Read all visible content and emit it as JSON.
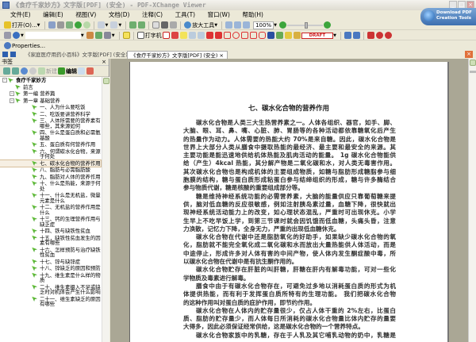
{
  "window": {
    "title": "《食疗千家妙方》文字版[PDF] (安全) - PDF-XChange Viewer"
  },
  "menu": [
    "文件(E)",
    "编辑(E)",
    "视图(V)",
    "文档(D)",
    "注释(C)",
    "工具(T)",
    "窗口(W)",
    "帮助(H)"
  ],
  "toolbar": {
    "open_label": "打开(O)...",
    "zoom_tool_label": "放大工具",
    "zoom_value": "100%",
    "typewriter_label": "打字机",
    "stamp_label": "DRAFT",
    "properties_label": "Properties..."
  },
  "download_badge": {
    "line1": "Download PDF",
    "line2": "Creation Tools"
  },
  "tabs": [
    {
      "label": "《家庭医疗用药小百科》文字版[PDF] (安全)"
    },
    {
      "label": "《食疗千家妙方》文字版[PDF] (安全)",
      "active": true
    }
  ],
  "bookmarks_pane": {
    "title": "书签",
    "new_label": "新建",
    "edit_label": "编辑"
  },
  "tree": [
    {
      "label": "食疗千家妙方",
      "level": 0,
      "expander": "⊟"
    },
    {
      "label": "前言",
      "level": 1
    },
    {
      "label": "第一编 营养篇",
      "level": 1,
      "expander": "⊟"
    },
    {
      "label": "第一章 基础营养",
      "level": 2,
      "expander": "⊟"
    },
    {
      "label": "一、人为什么要吃饭",
      "level": 3
    },
    {
      "label": "二、吃饭要讲营养科学",
      "level": 3
    },
    {
      "label": "三、人体所需要的营养素有哪些，其来源如何",
      "level": 3
    },
    {
      "label": "四、什么是蛋白质和必需氨基酸",
      "level": 3
    },
    {
      "label": "五、蛋白质有何营养作用",
      "level": 3
    },
    {
      "label": "六、何谓碳水化合物，来源于何处",
      "level": 3
    },
    {
      "label": "七、碳水化合物的营养作用",
      "level": 3,
      "selected": true
    },
    {
      "label": "八、脂肪与必需脂肪酸",
      "level": 3
    },
    {
      "label": "九、脂肪对人体的营养作用",
      "level": 3
    },
    {
      "label": "十、什么是热能，来源于何处",
      "level": 3
    },
    {
      "label": "十一、什么是无机盐，微量元素是什么",
      "level": 3
    },
    {
      "label": "十二、无机盐的营养作用是什么",
      "level": 3
    },
    {
      "label": "十三、钙的生理营养作用与缺乏症",
      "level": 3
    },
    {
      "label": "十四、铁与缺铁性贫血",
      "level": 3
    },
    {
      "label": "十五，缺铁性贫血发生的因素有哪些",
      "level": 3
    },
    {
      "label": "十六、怎样预防与治疗缺铁性贫血",
      "level": 3
    },
    {
      "label": "十七、锌与缺锌症",
      "level": 3
    },
    {
      "label": "十八、锌缺乏的原因和预防",
      "level": 3
    },
    {
      "label": "十九、维生素是什么样的物质",
      "level": 3
    },
    {
      "label": "二十、维生素摄入不足或缺乏时对机体会产生什么影响",
      "level": 3
    },
    {
      "label": "二十一、维生素缺乏的原因有哪些",
      "level": 3
    }
  ],
  "document": {
    "heading": "七、碳水化合物的营养作用",
    "lines": [
      {
        "t": "碳水化合物是人类三大生热营养素之一。人体各组织、器官，如手、脚、",
        "i": true
      },
      {
        "t": "大脑、眼、耳、鼻、嘴、心脏、肺、胃肠等的各种活动都依靠糖氧化后产生"
      },
      {
        "t": "的热量作为动力。人体需要的热能大约 70%是来自糖。因此，碳水化合物是"
      },
      {
        "t": "世界上大部分人类从膳食中摄取热能的最经济、最主要和最安全的来源。其"
      },
      {
        "t": "主要功能是能迅速地供给机体热能及肌肉活动的能量。 1g 碳水化合物能供"
      },
      {
        "t": "给（产生）4kcal 热能，其分解产物是二氧化碳和水，对人类无毒害作用。"
      },
      {
        "t": "其次碳水化合物也是构成机体的主要组成物质，如糖与脂肪形成糖脂参与细"
      },
      {
        "t": "胞膜的结构，糖与蛋白质形成粘蛋白参与结缔组织的形成，糖与许多酶结合"
      },
      {
        "t": "参与物质代谢，糖是核酸的重要组成部分等。",
        "e": true
      },
      {
        "t": "糖是维持神经系统功能的必需营养素，大脑的能量供应只靠葡萄糖来提",
        "i": true
      },
      {
        "t": "供，脑对低血糖的反应很敏感，例如注射胰岛素过量，血糖下降，很快就出"
      },
      {
        "t": "现神经系统活动能力上的改变，如心理状态混乱，严重时可出现休克。小学"
      },
      {
        "t": "生早上不吃早饭上学，到第三节课时就会因饥饿而低血糖，头痛头昏，注意"
      },
      {
        "t": "力涣散，记忆力下降，全身无力，严重的出现低血糖休克。",
        "e": true
      },
      {
        "t": "碳水化合物在代谢中还是脂肪氧化的好助手，如果缺少碳水化合物的氧",
        "i": true
      },
      {
        "t": "化，脂肪就不能完全氧化成二氧化碳和水而放出大量热能供人体活动，而是"
      },
      {
        "t": "中途停止，形成许多对人体有害的中间产物，使人体内发生酮症酸中毒，所"
      },
      {
        "t": "以碳水化合物在代谢中是有抗生酮作用的。",
        "e": true
      },
      {
        "t": "碳水化合物贮存在肝脏的叫肝糖，肝糖在肝内有解毒功能，可对一些化",
        "i": true
      },
      {
        "t": "学物质及毒素进行解毒。",
        "e": true
      },
      {
        "t": "膳食中由于有碳水化合物存在，可避免过多地以消耗蛋白质的形式为机",
        "i": true
      },
      {
        "t": "体提供热能，而有利于发挥蛋白质所特有的生理功能。 我们把碳水化合物"
      },
      {
        "t": "的这种作用叫对蛋白质的庇护作用，即节约作用。",
        "e": true
      },
      {
        "t": "碳水化合物在人体内的贮存量很少，仅占人体干重的 2%左右，比蛋白",
        "i": true
      },
      {
        "t": "质、脂肪的贮存量少，而人体每日所消耗的碳水化合物量比体内贮存的量要"
      },
      {
        "t": "大得多，因此必须保证经常供给，这是碳水化合物的一个营养特点。",
        "e": true
      },
      {
        "t": "碳水化合物家族中的乳糖，存在于人乳及其它哺乳动物的奶中，乳糖是",
        "i": true
      }
    ]
  }
}
